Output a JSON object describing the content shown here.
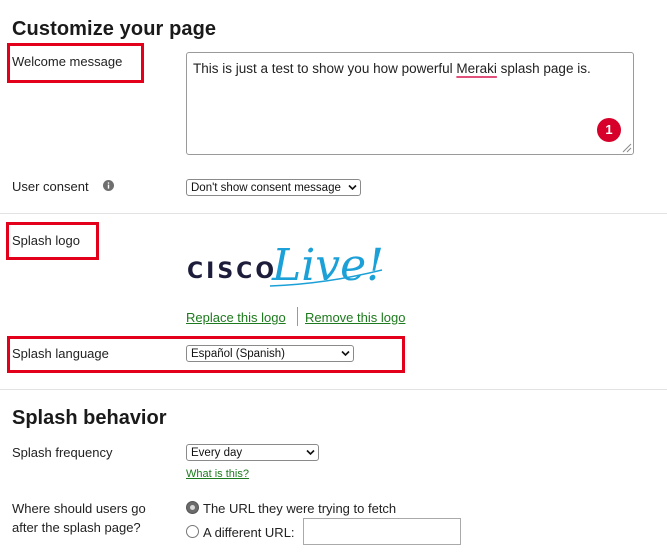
{
  "customize": {
    "title": "Customize your page",
    "welcome_label": "Welcome message",
    "welcome_text_before": "This is just a test to show you how powerful ",
    "welcome_text_underlined": "Meraki",
    "welcome_text_after": " splash page is.",
    "badge_count": "1",
    "user_consent_label": "User consent",
    "user_consent_selected": "Don't show consent message",
    "splash_logo_label": "Splash logo",
    "logo": {
      "brand_word": "CISCO",
      "script_word": "Live!"
    },
    "replace_logo_link": "Replace this logo",
    "remove_logo_link": "Remove this logo",
    "splash_language_label": "Splash language",
    "splash_language_selected": "Español (Spanish)"
  },
  "behavior": {
    "title": "Splash behavior",
    "frequency_label": "Splash frequency",
    "frequency_selected": "Every day",
    "what_is_this_link": "What is this?",
    "redirect_label_line1": "Where should users go",
    "redirect_label_line2": "after the splash page?",
    "option_original_url": "The URL they were trying to fetch",
    "option_different_url": "A different URL:",
    "different_url_value": ""
  },
  "colors": {
    "highlight_box": "#e3001b",
    "link_green": "#1e7a1e",
    "badge_red": "#d6002a",
    "logo_blue": "#1ba0d7",
    "logo_dark": "#1d1d3b"
  }
}
